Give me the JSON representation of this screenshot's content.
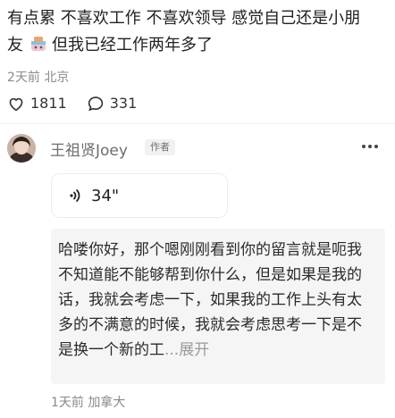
{
  "post": {
    "text_line1": "有点累 不喜欢工作 不喜欢领导 感觉自己还是小朋",
    "text_line2_start": "友",
    "text_line2_end": "但我已经工作两年多了",
    "emoji_icon": "baby-bottle-emoji-icon",
    "time": "2天前",
    "location": "北京"
  },
  "stats": {
    "likes": "1811",
    "comments": "331"
  },
  "comment": {
    "author": "王祖贤Joey",
    "badge": "作者",
    "voice": {
      "duration": "34\""
    },
    "transcript": "哈喽你好，那个嗯刚刚看到你的留言就是呃我不知道能不能够帮到你什么，但是如果是我的话，我就会考虑一下，如果我的工作上头有太多的不满意的时候，我就会考虑思考一下是不是换一个新的工",
    "ellipsis": "...",
    "expand": "展开",
    "time": "1天前",
    "location": "加拿大"
  },
  "colors": {
    "text": "#222222",
    "meta": "#8a8a8a",
    "transcript_bg": "#f5f5f5"
  }
}
